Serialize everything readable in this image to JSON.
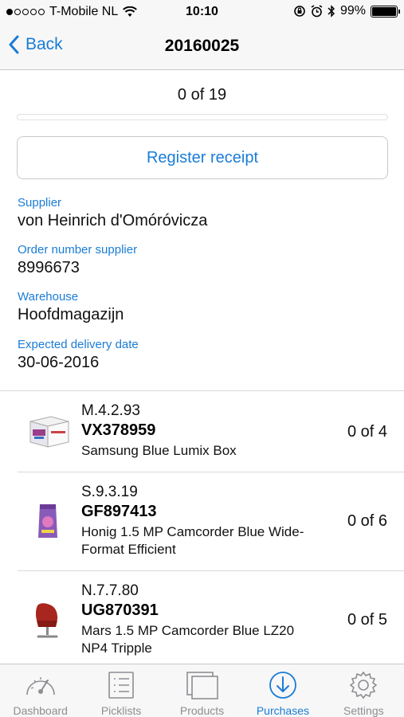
{
  "status_bar": {
    "carrier": "T-Mobile NL",
    "time": "10:10",
    "battery": "99%",
    "battery_level": 0.99,
    "signal_bars_filled": 1,
    "signal_bars_total": 5
  },
  "nav": {
    "back_label": "Back",
    "title": "20160025"
  },
  "progress": {
    "text": "0 of 19",
    "done": 0,
    "total": 19
  },
  "register_button": "Register receipt",
  "details": [
    {
      "label": "Supplier",
      "value": "von Heinrich d'Omóróvicza"
    },
    {
      "label": "Order number supplier",
      "value": "8996673"
    },
    {
      "label": "Warehouse",
      "value": "Hoofdmagazijn"
    },
    {
      "label": "Expected delivery date",
      "value": "30-06-2016"
    }
  ],
  "items": [
    {
      "location": "M.4.2.93",
      "code": "VX378959",
      "description_line1": "Samsung Blue Lumix Box",
      "description_line2": "",
      "count": "0 of 4",
      "thumb_icon": "product-box-icon"
    },
    {
      "location": "S.9.3.19",
      "code": "GF897413",
      "description_line1": "Honig 1.5 MP Camcorder Blue Wide-",
      "description_line2": "Format Efficient",
      "count": "0 of 6",
      "thumb_icon": "product-bag-icon"
    },
    {
      "location": "N.7.7.80",
      "code": "UG870391",
      "description_line1": "Mars 1.5 MP Camcorder Blue LZ20",
      "description_line2": "NP4 Tripple",
      "count": "0 of 5",
      "thumb_icon": "red-chair-icon"
    }
  ],
  "tabs": [
    {
      "label": "Dashboard",
      "icon": "gauge-icon",
      "active": false
    },
    {
      "label": "Picklists",
      "icon": "list-icon",
      "active": false
    },
    {
      "label": "Products",
      "icon": "boxes-icon",
      "active": false
    },
    {
      "label": "Purchases",
      "icon": "download-circle-icon",
      "active": true
    },
    {
      "label": "Settings",
      "icon": "gear-icon",
      "active": false
    }
  ],
  "colors": {
    "accent": "#1a7cd6",
    "inactive": "#8e8e93",
    "bar_background": "#f7f7f7"
  }
}
